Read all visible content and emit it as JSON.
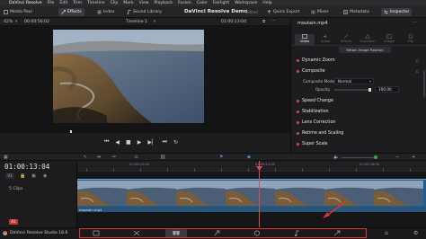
{
  "menubar": {
    "items": [
      "DaVinci Resolve",
      "File",
      "Edit",
      "Trim",
      "Timeline",
      "Clip",
      "Mark",
      "View",
      "Playback",
      "Fusion",
      "Color",
      "Fairlight",
      "Workspace",
      "Help"
    ]
  },
  "toolbar": {
    "media_pool": "Media Pool",
    "effects": "Effects",
    "index": "Index",
    "sound_library": "Sound Library",
    "project_title": "DaVinci Resolve Demo",
    "project_status": "Edited",
    "quick_export": "Quick Export",
    "mixer": "Mixer",
    "metadata": "Metadata",
    "inspector": "Inspector"
  },
  "viewer": {
    "zoom": "42%",
    "timecode_left": "00:00:56:02",
    "timeline_name": "Timeline 1",
    "timecode_right": "01:00:13:04"
  },
  "inspector": {
    "clip_name": "moutain.mp4",
    "tabs": [
      "Video",
      "Audio",
      "Effects",
      "Transition",
      "Image",
      "File"
    ],
    "retain_button": "Retain Image Position",
    "dynamic_zoom": "Dynamic Zoom",
    "composite": "Composite",
    "composite_mode_label": "Composite Mode",
    "composite_mode_value": "Normal",
    "opacity_label": "Opacity",
    "opacity_value": "100.00",
    "speed_change": "Speed Change",
    "stabilization": "Stabilization",
    "lens_correction": "Lens Correction",
    "retime_scaling": "Retime and Scaling",
    "super_scale": "Super Scale"
  },
  "timeline": {
    "timecode": "01:00:13:04",
    "clip_count": "5 Clips",
    "track_label": "V1",
    "audio_label": "A1",
    "clip_name": "moutain.mp4",
    "ruler_labels": [
      "01:00:10:00",
      "01:00:12:00",
      "01:00:18:00"
    ]
  },
  "pagebar": {
    "app_name": "DaVinci Resolve Studio 18.6"
  },
  "colors": {
    "accent_red": "#e0362c",
    "video_track": "#1f5f8f",
    "section_dot": "#d9435a"
  }
}
